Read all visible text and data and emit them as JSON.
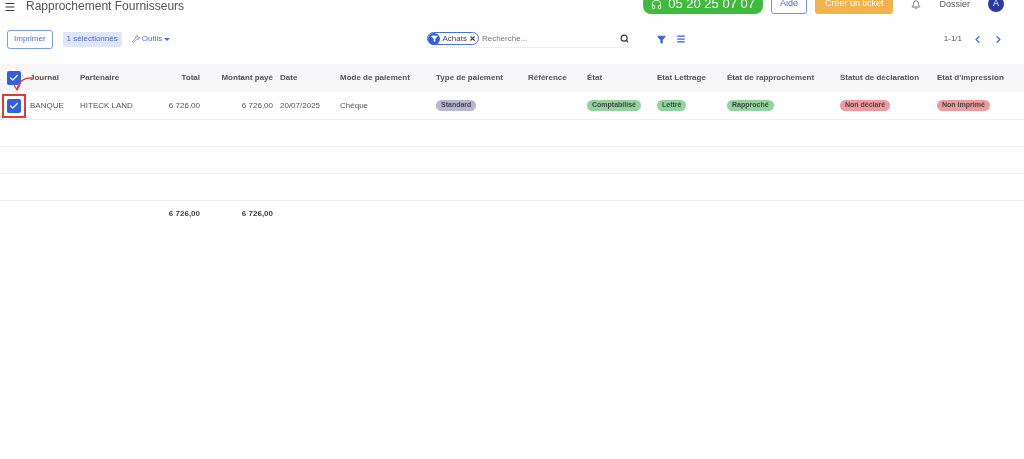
{
  "header": {
    "title": "Rapprochement Fournisseurs",
    "phone": "05 20 25 07 07",
    "help_button": "Aide",
    "ticket_button": "Créer un ticket",
    "folder": "Dossier",
    "avatar": "A"
  },
  "toolbar": {
    "print_button": "Imprimer",
    "selection_badge": "1 sélectionnés",
    "tools_menu": "Outils",
    "filter_chip": "Achats",
    "search": {
      "placeholder": "Recherche..."
    },
    "pagination": "1-1/1"
  },
  "table": {
    "select_all_checked": true,
    "columns": [
      "Journal",
      "Partenaire",
      "Total",
      "Montant payé",
      "Date",
      "Mode de paiement",
      "Type de paiement",
      "Référence",
      "État",
      "Etat Lettrage",
      "État de rapprochement",
      "Statut de déclaration",
      "Etat d'impression"
    ],
    "rows": [
      {
        "checked": true,
        "highlighted": true,
        "cells": [
          {
            "kind": "text",
            "text": "BANQUE"
          },
          {
            "kind": "text",
            "text": "HITECK LAND"
          },
          {
            "kind": "text",
            "text": "6 726,00"
          },
          {
            "kind": "text",
            "text": "6 726,00"
          },
          {
            "kind": "text",
            "text": "20/07/2025"
          },
          {
            "kind": "text",
            "text": "Chèque"
          },
          {
            "kind": "badge",
            "text": "Standard",
            "color": "#b9b6d3"
          },
          {
            "kind": "empty"
          },
          {
            "kind": "badge",
            "text": "Comptabilisé",
            "color": "#8fd49b"
          },
          {
            "kind": "badge",
            "text": "Lettré",
            "color": "#8fd49b"
          },
          {
            "kind": "badge",
            "text": "Rapproché",
            "color": "#8fd49b"
          },
          {
            "kind": "badge",
            "text": "Non déclaré",
            "color": "#ee9a9f"
          },
          {
            "kind": "badge",
            "text": "Non imprimé",
            "color": "#ee9a9f"
          }
        ]
      }
    ],
    "totals": {
      "total": "6 726,00",
      "amount_paid": "6 726,00"
    }
  }
}
